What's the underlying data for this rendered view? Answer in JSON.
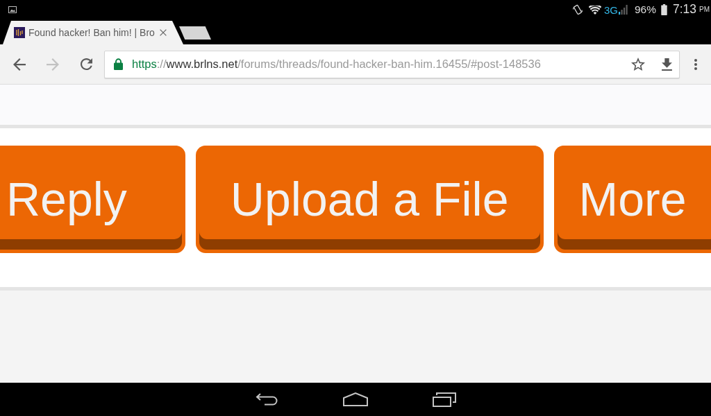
{
  "status_bar": {
    "network": "3G",
    "battery": "96%",
    "time": "7:13",
    "meridiem": "PM"
  },
  "tabs": [
    {
      "title": "Found hacker! Ban him! | Bro",
      "selected": true
    }
  ],
  "toolbar": {
    "nav_buttons": [
      {
        "kind": "back",
        "disabled": false
      },
      {
        "kind": "forward",
        "disabled": true
      },
      {
        "kind": "reload",
        "disabled": false
      }
    ],
    "address": {
      "secure": true,
      "scheme": "https",
      "separator": "://",
      "host": "www.brlns.net",
      "path": "/forums/threads/found-hacker-ban-him.16455/#post-148536"
    }
  },
  "page": {
    "buttons": [
      "Reply",
      "Upload a File",
      "More"
    ]
  }
}
